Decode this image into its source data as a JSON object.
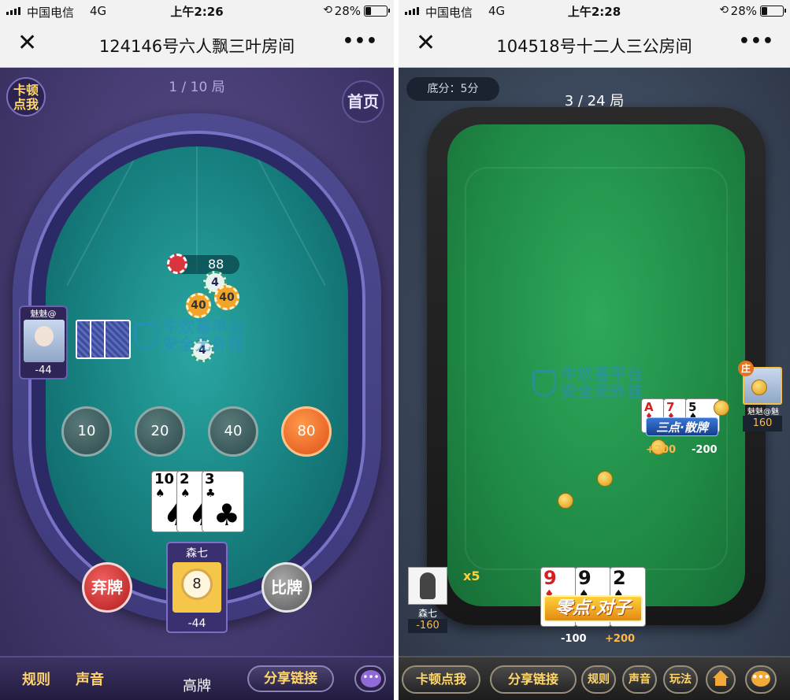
{
  "left": {
    "status": {
      "carrier": "中国电信",
      "network": "4G",
      "time": "上午2:26",
      "battery": "28%",
      "lock_icon": "rotation-lock-icon"
    },
    "nav": {
      "close": "✕",
      "title": "124146号六人飘三叶房间",
      "more": "•••"
    },
    "game": {
      "kadun_btn": "卡顿点我",
      "home_btn": "首页",
      "round": "1 / 10 局",
      "pot": "88",
      "chips": [
        "4",
        "40",
        "40",
        "4"
      ],
      "watermark": [
        "牛欢喜平台",
        "安全无外挂"
      ],
      "opponent": {
        "name": "魅魅@",
        "score": "-44"
      },
      "bets": [
        "10",
        "20",
        "40",
        "80"
      ],
      "active_bet": "80",
      "cards": [
        {
          "rank": "10",
          "suit": "♠"
        },
        {
          "rank": "2",
          "suit": "♠"
        },
        {
          "rank": "3",
          "suit": "♣"
        }
      ],
      "discard_btn": "弃牌",
      "compare_btn": "比牌",
      "self": {
        "name": "森七",
        "ball": "8",
        "score": "-44"
      }
    },
    "bottom": {
      "rules": "规则",
      "sound": "声音",
      "hand_type": "高牌",
      "share": "分享链接",
      "chat": "•••"
    }
  },
  "right": {
    "status": {
      "carrier": "中国电信",
      "network": "4G",
      "time": "上午2:28",
      "battery": "28%",
      "lock_icon": "rotation-lock-icon"
    },
    "nav": {
      "close": "✕",
      "title": "104518号十二人三公房间",
      "more": "•••"
    },
    "game": {
      "base_score": "底分：5分",
      "round": "3 / 24 局",
      "watermark": [
        "牛欢喜平台",
        "安全无外挂"
      ],
      "banker": {
        "tag": "庄",
        "name": "魅魅@魅",
        "score": "160"
      },
      "banker_cards": [
        {
          "rank": "A",
          "suit": "♦",
          "color": "#d42020"
        },
        {
          "rank": "7",
          "suit": "♦",
          "color": "#d42020"
        },
        {
          "rank": "5",
          "suit": "♠",
          "color": "#111111"
        }
      ],
      "banker_hand": "三点·散牌",
      "banker_result": "-200",
      "banker_gain": "+200",
      "self": {
        "name": "森七",
        "score": "-160"
      },
      "multiplier": "x5",
      "self_cards": [
        {
          "rank": "9",
          "suit": "♦",
          "color": "#d42020"
        },
        {
          "rank": "9",
          "suit": "♠",
          "color": "#111111"
        },
        {
          "rank": "2",
          "suit": "♠",
          "color": "#111111"
        }
      ],
      "self_hand": "零点·对子",
      "self_loss": "-100",
      "self_gain": "+200"
    },
    "bottom": {
      "kadun": "卡顿点我",
      "share": "分享链接",
      "rules": "规则",
      "sound": "声音",
      "play": "玩法",
      "home_icon": "home-icon",
      "chat": "•••"
    }
  }
}
